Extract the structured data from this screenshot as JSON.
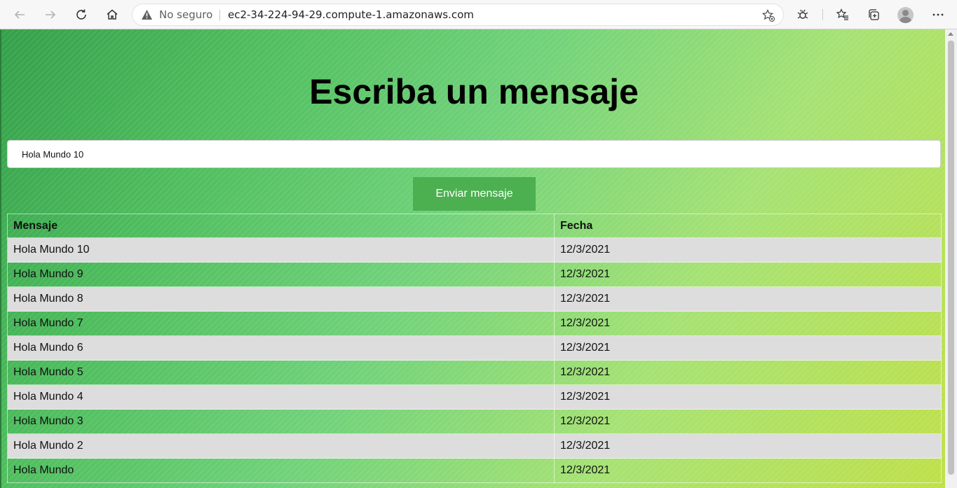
{
  "browser": {
    "security_label": "No seguro",
    "url": "ec2-34-224-94-29.compute-1.amazonaws.com"
  },
  "page": {
    "title": "Escriba un mensaje",
    "input_value": "Hola Mundo 10",
    "send_button_label": "Enviar mensaje",
    "table": {
      "headers": [
        "Mensaje",
        "Fecha"
      ],
      "rows": [
        {
          "mensaje": "Hola Mundo 10",
          "fecha": "12/3/2021"
        },
        {
          "mensaje": "Hola Mundo 9",
          "fecha": "12/3/2021"
        },
        {
          "mensaje": "Hola Mundo 8",
          "fecha": "12/3/2021"
        },
        {
          "mensaje": "Hola Mundo 7",
          "fecha": "12/3/2021"
        },
        {
          "mensaje": "Hola Mundo 6",
          "fecha": "12/3/2021"
        },
        {
          "mensaje": "Hola Mundo 5",
          "fecha": "12/3/2021"
        },
        {
          "mensaje": "Hola Mundo 4",
          "fecha": "12/3/2021"
        },
        {
          "mensaje": "Hola Mundo 3",
          "fecha": "12/3/2021"
        },
        {
          "mensaje": "Hola Mundo 2",
          "fecha": "12/3/2021"
        },
        {
          "mensaje": "Hola Mundo",
          "fecha": "12/3/2021"
        }
      ]
    }
  },
  "colors": {
    "button": "#4caf50",
    "striped_row": "#dddddd",
    "gradient_start": "#33a04a",
    "gradient_end": "#bfe049"
  },
  "icons": [
    "back-icon",
    "forward-icon",
    "reload-icon",
    "home-icon",
    "warning-icon",
    "add-favorite-icon",
    "extension-icon",
    "favorites-icon",
    "collections-icon",
    "profile-avatar",
    "more-icon"
  ]
}
